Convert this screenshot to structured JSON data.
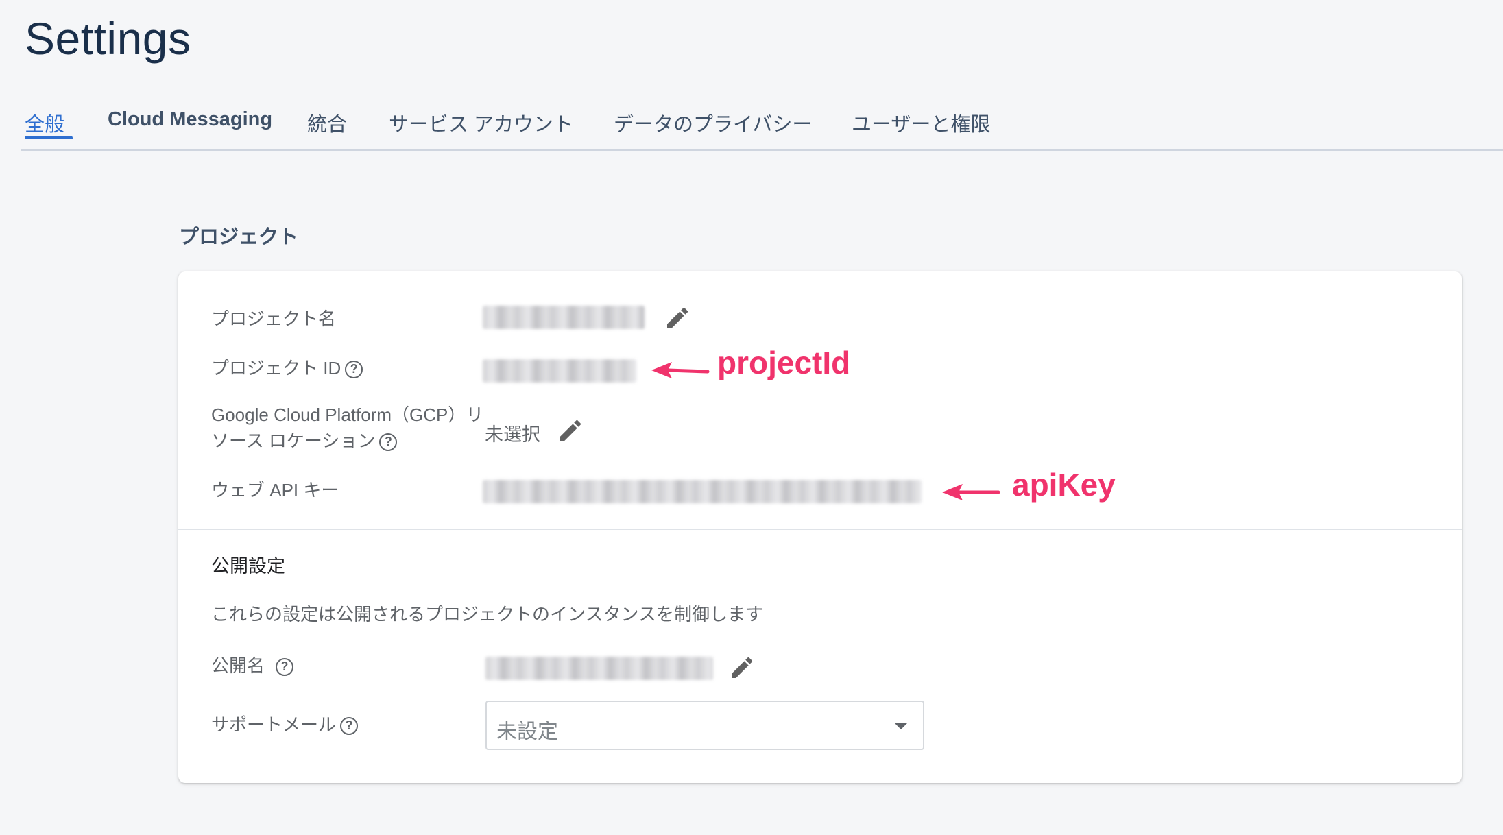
{
  "page": {
    "title": "Settings"
  },
  "tabs": [
    {
      "label": "全般",
      "active": true
    },
    {
      "label": "Cloud Messaging"
    },
    {
      "label": "統合"
    },
    {
      "label": "サービス アカウント"
    },
    {
      "label": "データのプライバシー"
    },
    {
      "label": "ユーザーと権限"
    }
  ],
  "project_section": {
    "heading": "プロジェクト",
    "fields": {
      "project_name": {
        "label": "プロジェクト名"
      },
      "project_id": {
        "label": "プロジェクト ID"
      },
      "gcp_location": {
        "label_line1": "Google Cloud Platform（GCP）リ",
        "label_line2": "ソース ロケーション",
        "value": "未選択"
      },
      "web_api_key": {
        "label": "ウェブ API キー"
      }
    }
  },
  "public_section": {
    "heading": "公開設定",
    "description": "これらの設定は公開されるプロジェクトのインスタンスを制御します",
    "fields": {
      "public_name": {
        "label": "公開名"
      },
      "support_email": {
        "label": "サポートメール",
        "selected": "未設定"
      }
    }
  },
  "annotations": {
    "project_id_note": "projectId",
    "api_key_note": "apiKey"
  },
  "help_glyph": "?",
  "colors": {
    "accent": "#2f6fd0",
    "annotation": "#f0336c",
    "title": "#1a2f4a"
  },
  "icons": [
    "pencil-icon",
    "help-icon",
    "arrow-left-icon",
    "dropdown-caret-icon"
  ]
}
